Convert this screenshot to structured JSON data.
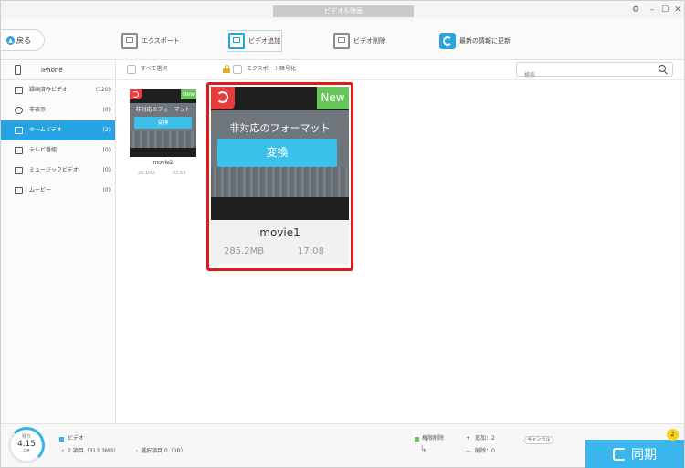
{
  "window": {
    "title": "ビデオ＆映画"
  },
  "toolbar": {
    "back_label": "戻る",
    "tools": [
      {
        "label": "エクスポート",
        "icon": "export-icon"
      },
      {
        "label": "ビデオ追加",
        "icon": "add-video-icon"
      },
      {
        "label": "ビデオ削除",
        "icon": "delete-video-icon"
      },
      {
        "label": "最新の情報に更新",
        "icon": "refresh-icon"
      }
    ]
  },
  "sidebar": {
    "device": "iPhone",
    "items": [
      {
        "label": "録画済みビデオ",
        "count": "(120)",
        "icon": "video-camera-icon"
      },
      {
        "label": "非表示",
        "count": "(0)",
        "icon": "hidden-eye-icon"
      },
      {
        "label": "ホームビデオ",
        "count": "(2)",
        "icon": "home-video-icon",
        "active": true
      },
      {
        "label": "テレビ番組",
        "count": "(0)",
        "icon": "tv-icon"
      },
      {
        "label": "ミュージックビデオ",
        "count": "(0)",
        "icon": "music-video-icon"
      },
      {
        "label": "ムービー",
        "count": "(0)",
        "icon": "film-icon"
      }
    ]
  },
  "content": {
    "select_all_label": "すべて選択",
    "export_encrypt_label": "エクスポート暗号化",
    "search_placeholder": "検索"
  },
  "videos": [
    {
      "name": "movie2",
      "size": "26.1MB",
      "duration": "02:53",
      "badge": "New",
      "format_text": "非対応のフォーマット",
      "convert_label": "変換"
    },
    {
      "name": "movie1",
      "size": "285.2MB",
      "duration": "17:08",
      "badge": "New",
      "format_text": "非対応のフォーマット",
      "convert_label": "変換"
    }
  ],
  "footer": {
    "storage_label": "残り",
    "storage_value": "4.15",
    "storage_unit": "GB",
    "category_label": "ビデオ",
    "items_summary": "2 項目（313.3MB）",
    "selected_summary": "選択項目 0（0B）",
    "permission_delete_label": "権限削除",
    "add_label": "追加：2",
    "delete_label": "削除：0",
    "cancel_label": "キャンセル",
    "sync_label": "同期",
    "sync_badge": "2"
  },
  "colors": {
    "accent": "#27a3e3",
    "new_badge": "#67c659",
    "undo_badge": "#ea3b3b",
    "highlight": "#e01a1a",
    "convert_button": "#3bc0ea",
    "sync_badge": "#f7d21c"
  }
}
